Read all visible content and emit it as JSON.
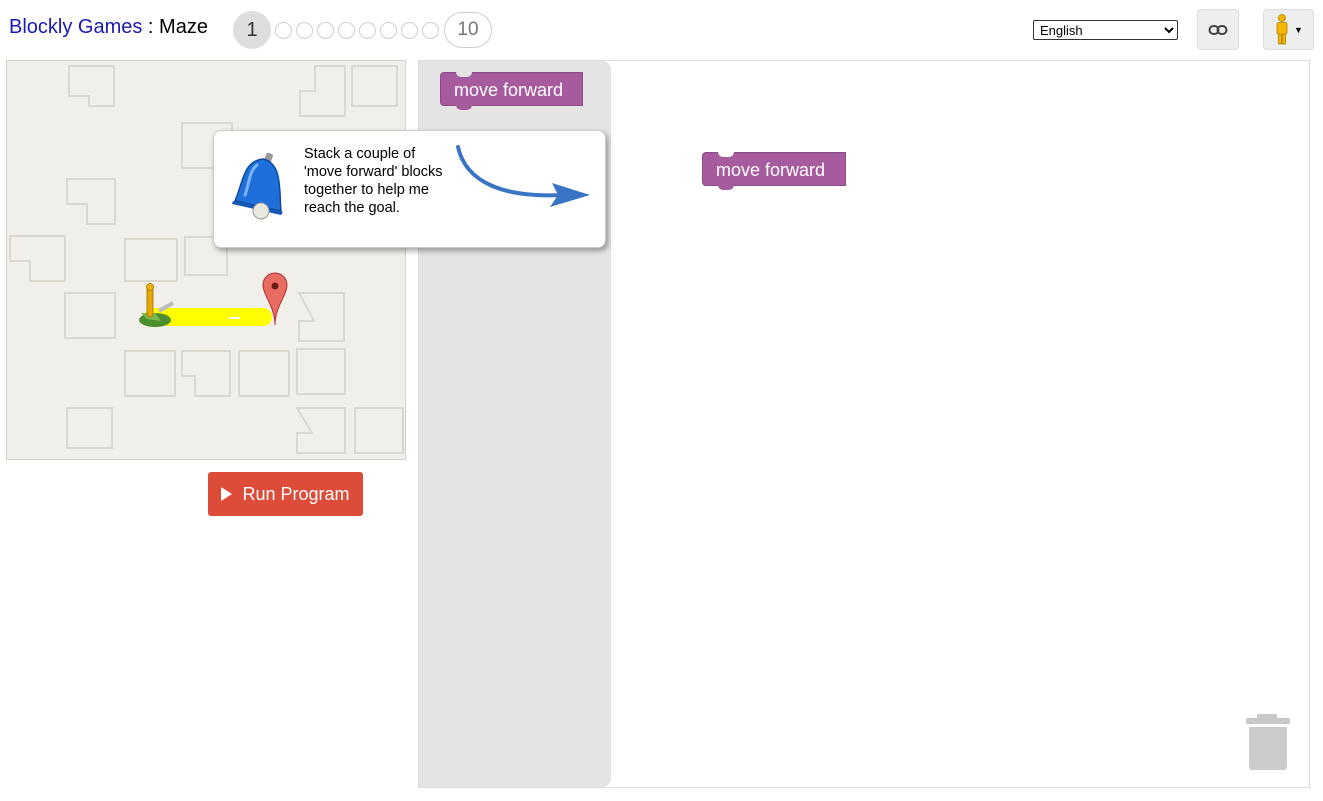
{
  "header": {
    "app_title": "Blockly Games",
    "separator": " : ",
    "game_title": "Maze",
    "levels": {
      "current": "1",
      "last": "10"
    },
    "language": {
      "selected": "English"
    },
    "link_icon": "link-icon",
    "pegman_icon": "pegman-icon"
  },
  "maze": {
    "start_icon": "pegman-icon",
    "goal_icon": "map-marker-icon"
  },
  "controls": {
    "run_label": "Run Program",
    "run_icon": "play-icon"
  },
  "toolbox": {
    "blocks": [
      {
        "label": "move forward"
      }
    ]
  },
  "workspace": {
    "blocks": [
      {
        "label": "move forward"
      }
    ],
    "trash_icon": "trash-can-icon"
  },
  "hint": {
    "text": "Stack a couple of 'move forward' blocks together to help me reach the goal.",
    "icon": "bell-icon",
    "pointer_icon": "arrow-icon"
  },
  "colors": {
    "block": "#a55b9e",
    "run_button": "#dd4b39",
    "path": "#ffff00",
    "flyout": "#e4e4e4",
    "maze_bg": "#f1efea"
  }
}
